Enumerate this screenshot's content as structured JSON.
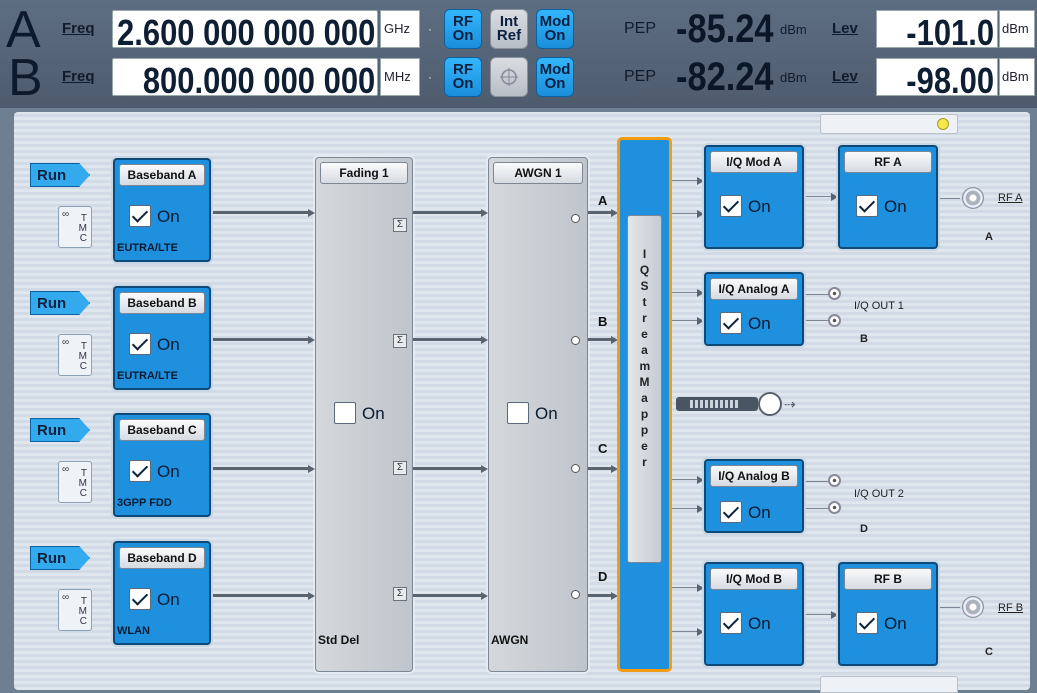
{
  "path_a": {
    "label": "A",
    "freq_link": "Freq",
    "freq_value": "2.600 000 000 000",
    "freq_unit": "GHz",
    "rf": "RF On",
    "ref": "Int Ref",
    "mod": "Mod On",
    "pep_label": "PEP",
    "pep_value": "-85.24",
    "pep_unit": "dBm",
    "lev_link": "Lev",
    "lev_value": "-101.0",
    "lev_unit": "dBm"
  },
  "path_b": {
    "label": "B",
    "freq_link": "Freq",
    "freq_value": "800.000 000 000",
    "freq_unit": "MHz",
    "rf": "RF On",
    "mod": "Mod On",
    "pep_label": "PEP",
    "pep_value": "-82.24",
    "pep_unit": "dBm",
    "lev_link": "Lev",
    "lev_value": "-98.00",
    "lev_unit": "dBm"
  },
  "basebands": [
    {
      "run": "Run",
      "title": "Baseband A",
      "on": "On",
      "sub": "EUTRA/LTE"
    },
    {
      "run": "Run",
      "title": "Baseband B",
      "on": "On",
      "sub": "EUTRA/LTE"
    },
    {
      "run": "Run",
      "title": "Baseband C",
      "on": "On",
      "sub": "3GPP FDD"
    },
    {
      "run": "Run",
      "title": "Baseband D",
      "on": "On",
      "sub": "WLAN"
    }
  ],
  "fading": {
    "title": "Fading 1",
    "on": "On",
    "bottom": "Std Del"
  },
  "awgn": {
    "title": "AWGN 1",
    "on": "On",
    "bottom": "AWGN"
  },
  "channels": [
    "A",
    "B",
    "C",
    "D"
  ],
  "mapper": {
    "text": "I Q S t r e a m M a p p e r"
  },
  "iq_mod_a": {
    "title": "I/Q Mod A",
    "on": "On"
  },
  "rf_a": {
    "title": "RF A",
    "on": "On",
    "connector": "RF A",
    "path": "A"
  },
  "iq_analog_a": {
    "title": "I/Q Analog A",
    "on": "On",
    "out": "I/Q OUT 1",
    "path": "B"
  },
  "iq_analog_b": {
    "title": "I/Q Analog B",
    "on": "On",
    "out": "I/Q OUT 2",
    "path": "D"
  },
  "iq_mod_b": {
    "title": "I/Q Mod B",
    "on": "On"
  },
  "rf_b": {
    "title": "RF B",
    "on": "On",
    "connector": "RF B",
    "path": "C"
  },
  "tmc": {
    "t": "T",
    "m": "M",
    "c": "C"
  }
}
